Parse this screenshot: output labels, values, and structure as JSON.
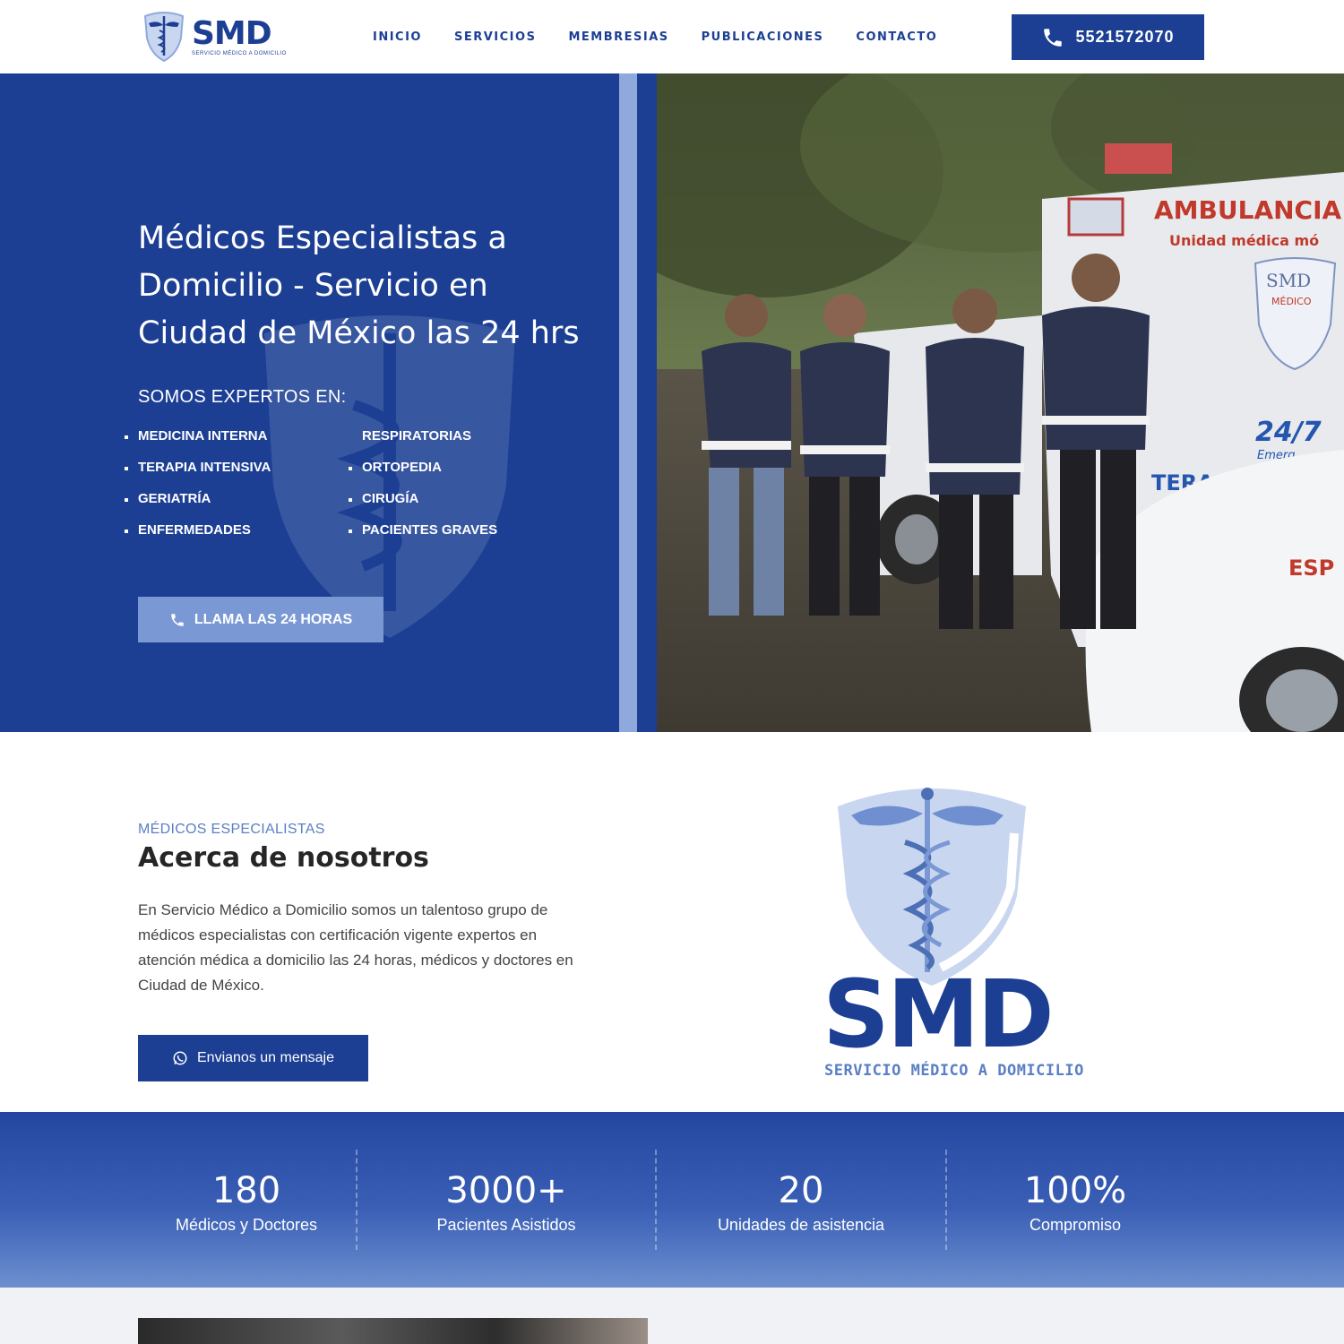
{
  "brand": {
    "name": "SMD",
    "tagline": "SERVICIO MÉDICO A DOMICILIO",
    "primary_color": "#1c3f94",
    "accent_color": "#7a99d4"
  },
  "nav": {
    "items": [
      {
        "label": "INICIO"
      },
      {
        "label": "SERVICIOS"
      },
      {
        "label": "MEMBRESIAS"
      },
      {
        "label": "PUBLICACIONES"
      },
      {
        "label": "CONTACTO"
      }
    ],
    "phone_label": "5521572070",
    "phone_icon": "phone-icon"
  },
  "hero": {
    "title": "Médicos Especialistas a Domicilio - Servicio en Ciudad de México las 24 hrs",
    "subtitle": "SOMOS EXPERTOS EN:",
    "list_a": [
      "MEDICINA INTERNA",
      "TERAPIA INTENSIVA",
      "GERIATRÍA",
      "ENFERMEDADES"
    ],
    "list_b": [
      "RESPIRATORIAS",
      "ORTOPEDIA",
      "CIRUGÍA",
      "PACIENTES GRAVES"
    ],
    "cta_label": "LLAMA LAS 24 HORAS",
    "photo_texts": {
      "ambulance": "AMBULANCIA CU",
      "unit": "Unidad médica mó",
      "shield": "SMD",
      "shield_sub": "MÉDICO",
      "service": "24/7",
      "service_sub": "Emerg",
      "side": "TERA",
      "car": "ESP"
    }
  },
  "about": {
    "kicker": "MÉDICOS ESPECIALISTAS",
    "title": "Acerca de nosotros",
    "text": "En Servicio Médico a Domicilio somos un talentoso grupo de médicos especialistas con certificación vigente expertos en atención médica a domicilio las 24 horas, médicos y doctores en Ciudad de México.",
    "button_label": "Envianos un mensaje",
    "button_icon": "whatsapp-icon",
    "logo_word": "SMD",
    "logo_sub": "SERVICIO MÉDICO A DOMICILIO"
  },
  "stats": [
    {
      "value": "180",
      "label": "Médicos y Doctores"
    },
    {
      "value": "3000+",
      "label": "Pacientes Asistidos"
    },
    {
      "value": "20",
      "label": "Unidades de asistencia"
    },
    {
      "value": "100%",
      "label": "Compromiso"
    }
  ]
}
